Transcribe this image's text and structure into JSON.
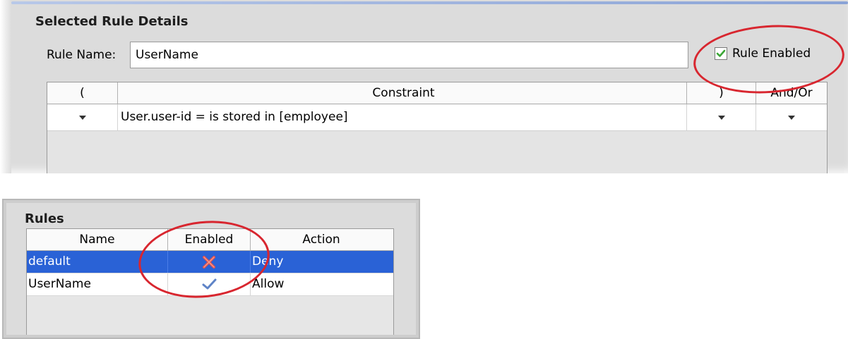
{
  "details": {
    "title": "Selected Rule Details",
    "rule_name_label": "Rule Name:",
    "rule_name_value": "UserName",
    "rule_enabled_label": "Rule Enabled",
    "rule_enabled_checked": true,
    "grid": {
      "headers": {
        "open": "(",
        "constraint": "Constraint",
        "close": ")",
        "andor": "And/Or"
      },
      "rows": [
        {
          "constraint": "User.user-id  =  is stored in [employee]"
        }
      ]
    }
  },
  "rules": {
    "title": "Rules",
    "headers": {
      "name": "Name",
      "enabled": "Enabled",
      "action": "Action"
    },
    "rows": [
      {
        "name": "default",
        "enabled": false,
        "enabled_icon": "red-x-icon",
        "action": "Deny",
        "selected": true
      },
      {
        "name": "UserName",
        "enabled": true,
        "enabled_icon": "blue-check-icon",
        "action": "Allow",
        "selected": false
      }
    ]
  },
  "colors": {
    "selection": "#2a62d6",
    "annotation": "#d8262f",
    "check_green": "#3aa635"
  }
}
